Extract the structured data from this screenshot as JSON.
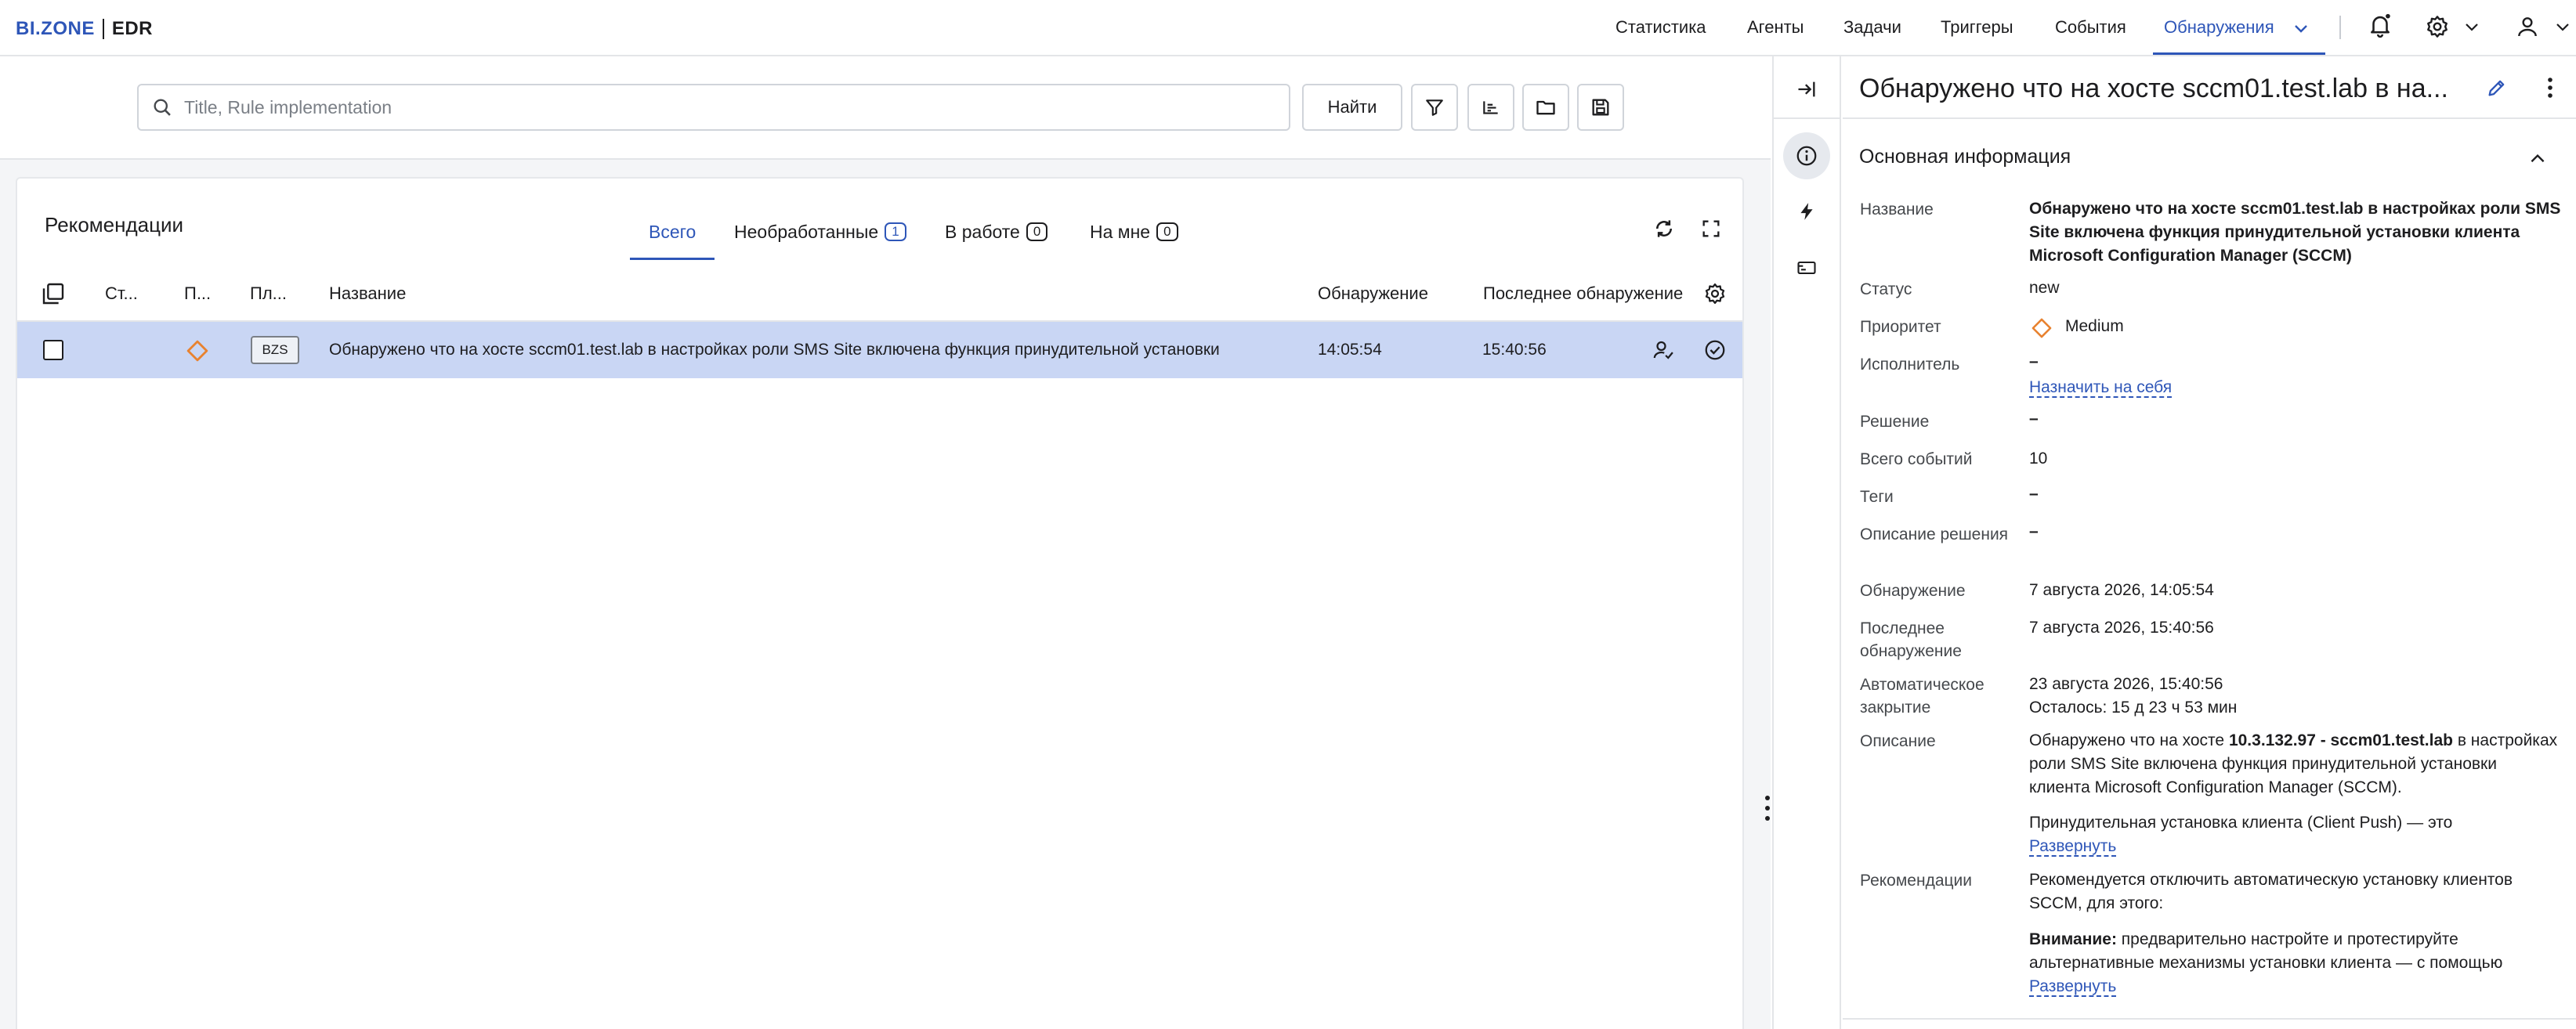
{
  "brand": {
    "logo": "BI.ZONE",
    "product": "EDR"
  },
  "nav": [
    {
      "label": "Статистика"
    },
    {
      "label": "Агенты"
    },
    {
      "label": "Задачи"
    },
    {
      "label": "Триггеры"
    },
    {
      "label": "События"
    },
    {
      "label": "Обнаружения",
      "active": true
    }
  ],
  "search": {
    "placeholder": "Title, Rule implementation",
    "value": "",
    "button": "Найти"
  },
  "panel": {
    "title": "Рекомендации",
    "tabs": [
      {
        "label": "Всего",
        "active": true
      },
      {
        "label": "Необработанные",
        "count": "1"
      },
      {
        "label": "В работе",
        "count": "0"
      },
      {
        "label": "На мне",
        "count": "0"
      }
    ]
  },
  "table": {
    "columns": [
      "Ст...",
      "П...",
      "Пл...",
      "Название",
      "Обнаружение",
      "Последнее обнаружение"
    ],
    "rows": [
      {
        "platform": "BZS",
        "name": "Обнаружено что на хосте sccm01.test.lab в настройках роли SMS Site включена функция принудительной установки",
        "detected": "14:05:54",
        "last_detected": "15:40:56",
        "selected": true
      }
    ]
  },
  "details": {
    "title": "Обнаружено что на хосте sccm01.test.lab в на...",
    "section": "Основная информация",
    "fields": {
      "name_label": "Название",
      "name_value": "Обнаружено что на хосте sccm01.test.lab в настройках роли SMS Site включена функция принудительной установки клиента Microsoft Configuration Manager (SCCM)",
      "status_label": "Статус",
      "status_value": "new",
      "priority_label": "Приоритет",
      "priority_value": "Medium",
      "assignee_label": "Исполнитель",
      "assignee_value": "–",
      "assign_link": "Назначить на себя",
      "resolution_label": "Решение",
      "resolution_value": "–",
      "events_label": "Всего событий",
      "events_value": "10",
      "tags_label": "Теги",
      "tags_value": "–",
      "resdesc_label": "Описание решения",
      "resdesc_value": "–",
      "detect_label": "Обнаружение",
      "detect_value": "7 августа 2026, 14:05:54",
      "last_label": "Последнее обнаружение",
      "last_value": "7 августа 2026, 15:40:56",
      "autoclose_label": "Автоматическое закрытие",
      "autoclose_value": "23 августа 2026, 15:40:56",
      "autoclose_remaining": "Осталось: 15 д 23 ч 53 мин",
      "desc_label": "Описание",
      "desc_prefix": "Обнаружено что на хосте ",
      "desc_bold": "10.3.132.97 - sccm01.test.lab",
      "desc_suffix": " в настройках роли SMS Site включена функция принудительной установки клиента Microsoft Configuration Manager (SCCM).",
      "desc_extra": "Принудительная установка клиента (Client Push) — это",
      "expand": "Развернуть",
      "rec_label": "Рекомендации",
      "rec_text": "Рекомендуется отключить автоматическую установку клиентов SCCM, для этого:",
      "rec_warn_bold": "Внимание:",
      "rec_warn_text": " предварительно настройте и протестируйте альтернативные механизмы установки клиента — с помощью",
      "rec_expand": "Развернуть"
    }
  },
  "colors": {
    "accent": "#2e56b8",
    "selected_row": "#c9d6f4",
    "priority_medium": "#e8822f"
  }
}
